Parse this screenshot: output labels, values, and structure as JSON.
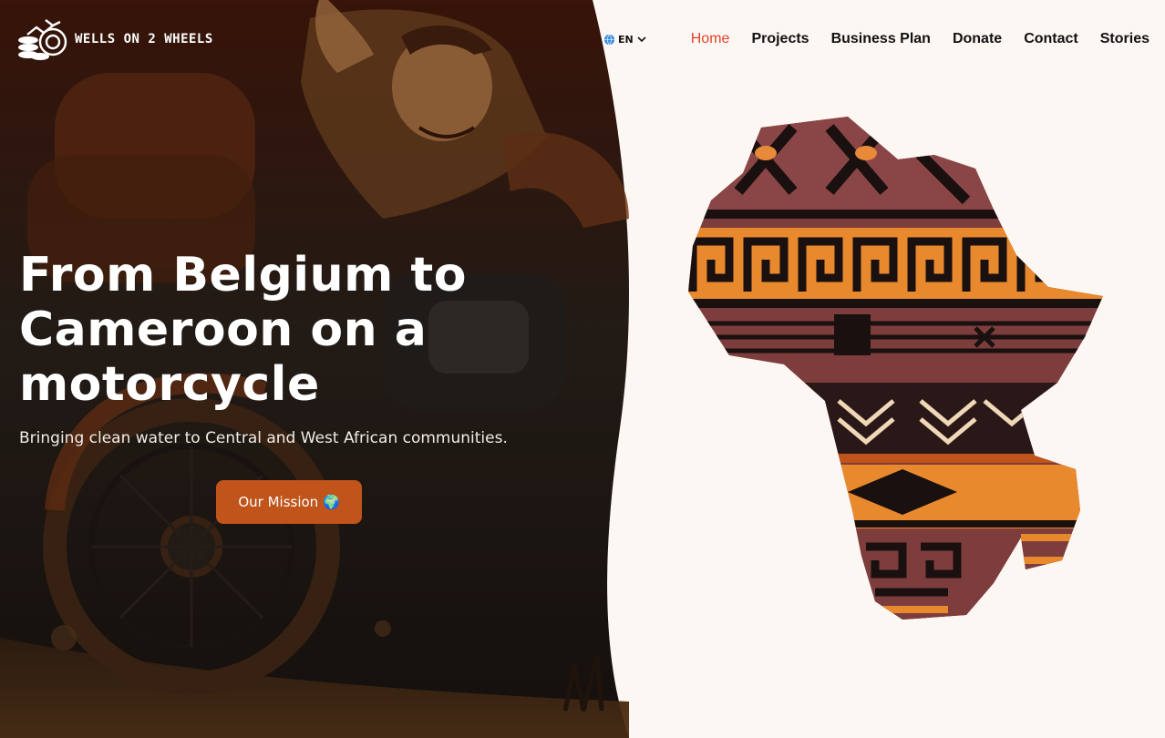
{
  "brand": {
    "name": "WELLS ON 2 WHEELS",
    "logo_icon": "bicycle-coins-logo"
  },
  "header": {
    "language": {
      "flag_icon": "globe-icon",
      "code": "EN",
      "chevron_icon": "chevron-down-icon"
    },
    "nav": [
      {
        "label": "Home",
        "active": true
      },
      {
        "label": "Projects"
      },
      {
        "label": "Business Plan"
      },
      {
        "label": "Donate"
      },
      {
        "label": "Contact"
      },
      {
        "label": "Stories"
      }
    ]
  },
  "hero": {
    "title": "From Belgium to Cameroon on a motorcycle",
    "subtitle": "Bringing clean water to Central and West African communities.",
    "cta_label": "Our Mission 🌍"
  },
  "colors": {
    "accent": "#e2422a",
    "cta": "#c0541a",
    "cream": "#fdf7f3",
    "dark": "#2a1a12"
  }
}
